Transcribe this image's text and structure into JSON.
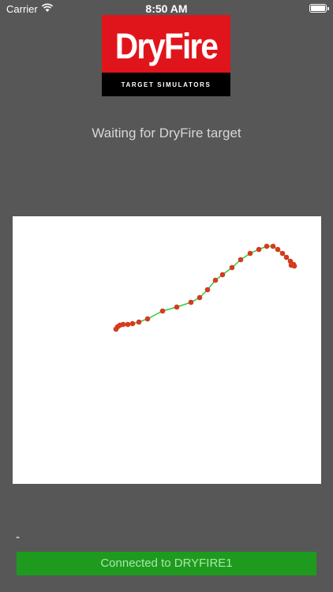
{
  "status_bar": {
    "carrier": "Carrier",
    "time": "8:50 AM"
  },
  "logo": {
    "word": "DryFire",
    "subtitle": "TARGET SIMULATORS"
  },
  "status_message": "Waiting for DryFire target",
  "trace": {
    "line_color": "#2ecc40",
    "point_color": "#d63a1f",
    "points": [
      [
        147,
        417
      ],
      [
        149,
        414
      ],
      [
        152,
        412
      ],
      [
        156,
        411
      ],
      [
        162,
        411
      ],
      [
        168,
        410
      ],
      [
        176,
        408
      ],
      [
        187,
        404
      ],
      [
        206,
        394
      ],
      [
        224,
        389
      ],
      [
        242,
        383
      ],
      [
        253,
        377
      ],
      [
        263,
        367
      ],
      [
        273,
        355
      ],
      [
        282,
        348
      ],
      [
        294,
        339
      ],
      [
        305,
        329
      ],
      [
        317,
        321
      ],
      [
        328,
        316
      ],
      [
        338,
        312
      ],
      [
        346,
        312
      ],
      [
        352,
        316
      ],
      [
        358,
        321
      ],
      [
        363,
        326
      ],
      [
        368,
        331
      ],
      [
        372,
        335
      ],
      [
        369,
        336
      ],
      [
        373,
        337
      ]
    ]
  },
  "readout": "-",
  "connection_button": {
    "label": "Connected to DRYFIRE1",
    "color": "#1e9b1e"
  }
}
